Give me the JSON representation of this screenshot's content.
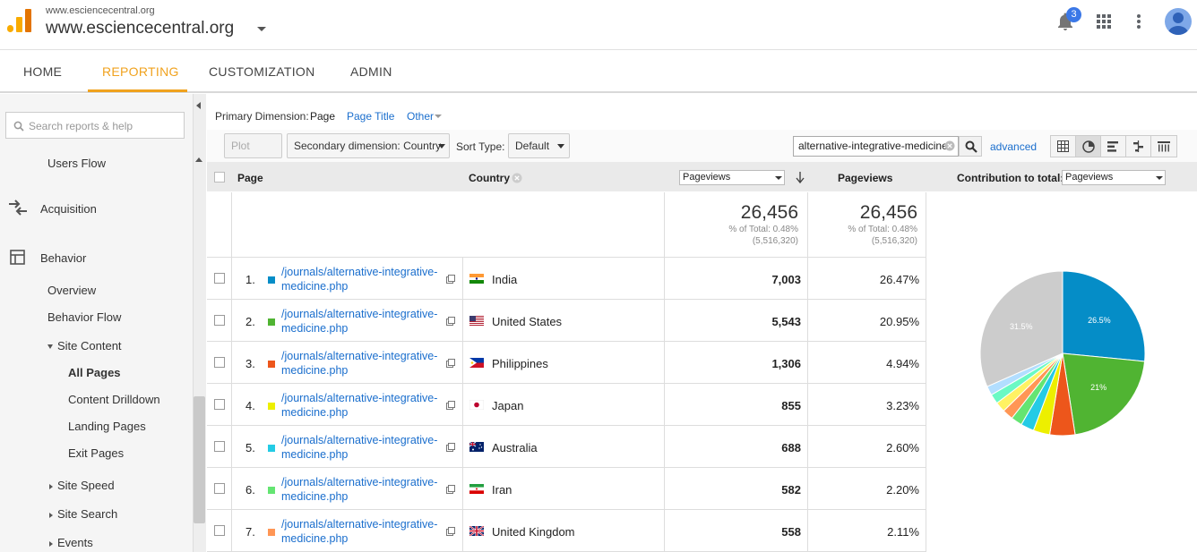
{
  "header": {
    "site_small": "www.esciencecentral.org",
    "site_big": "www.esciencecentral.org",
    "notification_count": "3"
  },
  "nav": {
    "tabs": [
      "HOME",
      "REPORTING",
      "CUSTOMIZATION",
      "ADMIN"
    ],
    "active_tab": "REPORTING",
    "active_color": "#f0a21e"
  },
  "sidebar": {
    "search_placeholder": "Search reports & help",
    "items": {
      "users_flow": "Users Flow",
      "acquisition": "Acquisition",
      "behavior": "Behavior",
      "overview": "Overview",
      "behavior_flow": "Behavior Flow",
      "site_content": "Site Content",
      "all_pages": "All Pages",
      "content_drilldown": "Content Drilldown",
      "landing_pages": "Landing Pages",
      "exit_pages": "Exit Pages",
      "site_speed": "Site Speed",
      "site_search": "Site Search",
      "events": "Events"
    }
  },
  "report": {
    "primary_dimension_label": "Primary Dimension:",
    "primary_options": [
      "Page",
      "Page Title",
      "Other"
    ],
    "plot_rows": "Plot Rows",
    "secondary_dimension": "Secondary dimension: Country",
    "sort_type_label": "Sort Type:",
    "sort_type_value": "Default",
    "filter_value": "alternative-integrative-medicine",
    "advanced_link": "advanced"
  },
  "table": {
    "headers": {
      "page": "Page",
      "country": "Country",
      "metric_select": "Pageviews",
      "pageviews": "Pageviews",
      "contribution_label": "Contribution to total:",
      "contribution_select": "Pageviews"
    },
    "summary": {
      "value": "26,456",
      "pct_line": "% of Total: 0.48%",
      "total_line": "(5,516,320)",
      "value2": "26,456",
      "pct_line2": "% of Total: 0.48%",
      "total_line2": "(5,516,320)"
    },
    "rows": [
      {
        "num": "1.",
        "page_line1": "/journals/alternative-integrative-",
        "page_line2": "medicine.php",
        "country": "India",
        "pageviews": "7,003",
        "pct": "26.47%",
        "color": "#058dc7"
      },
      {
        "num": "2.",
        "page_line1": "/journals/alternative-integrative-",
        "page_line2": "medicine.php",
        "country": "United States",
        "pageviews": "5,543",
        "pct": "20.95%",
        "color": "#50b432"
      },
      {
        "num": "3.",
        "page_line1": "/journals/alternative-integrative-",
        "page_line2": "medicine.php",
        "country": "Philippines",
        "pageviews": "1,306",
        "pct": "4.94%",
        "color": "#ed561b"
      },
      {
        "num": "4.",
        "page_line1": "/journals/alternative-integrative-",
        "page_line2": "medicine.php",
        "country": "Japan",
        "pageviews": "855",
        "pct": "3.23%",
        "color": "#edef00"
      },
      {
        "num": "5.",
        "page_line1": "/journals/alternative-integrative-",
        "page_line2": "medicine.php",
        "country": "Australia",
        "pageviews": "688",
        "pct": "2.60%",
        "color": "#24cbe5"
      },
      {
        "num": "6.",
        "page_line1": "/journals/alternative-integrative-",
        "page_line2": "medicine.php",
        "country": "Iran",
        "pageviews": "582",
        "pct": "2.20%",
        "color": "#64e572"
      },
      {
        "num": "7.",
        "page_line1": "/journals/alternative-integrative-",
        "page_line2": "medicine.php",
        "country": "United Kingdom",
        "pageviews": "558",
        "pct": "2.11%",
        "color": "#ff9655"
      }
    ]
  },
  "chart_data": {
    "type": "pie",
    "slices": [
      {
        "value": 26.47,
        "color": "#058dc7",
        "label": "26.5%"
      },
      {
        "value": 20.95,
        "color": "#50b432",
        "label": "21%"
      },
      {
        "value": 4.94,
        "color": "#ed561b",
        "label": ""
      },
      {
        "value": 3.23,
        "color": "#edef00",
        "label": ""
      },
      {
        "value": 2.6,
        "color": "#24cbe5",
        "label": ""
      },
      {
        "value": 2.2,
        "color": "#64e572",
        "label": ""
      },
      {
        "value": 2.11,
        "color": "#ff9655",
        "label": ""
      },
      {
        "value": 2.0,
        "color": "#fff263",
        "label": ""
      },
      {
        "value": 1.9,
        "color": "#6af9c4",
        "label": ""
      },
      {
        "value": 1.8,
        "color": "#b2deff",
        "label": ""
      },
      {
        "value": 31.5,
        "color": "#cccccc",
        "label": "31.5%"
      }
    ]
  }
}
